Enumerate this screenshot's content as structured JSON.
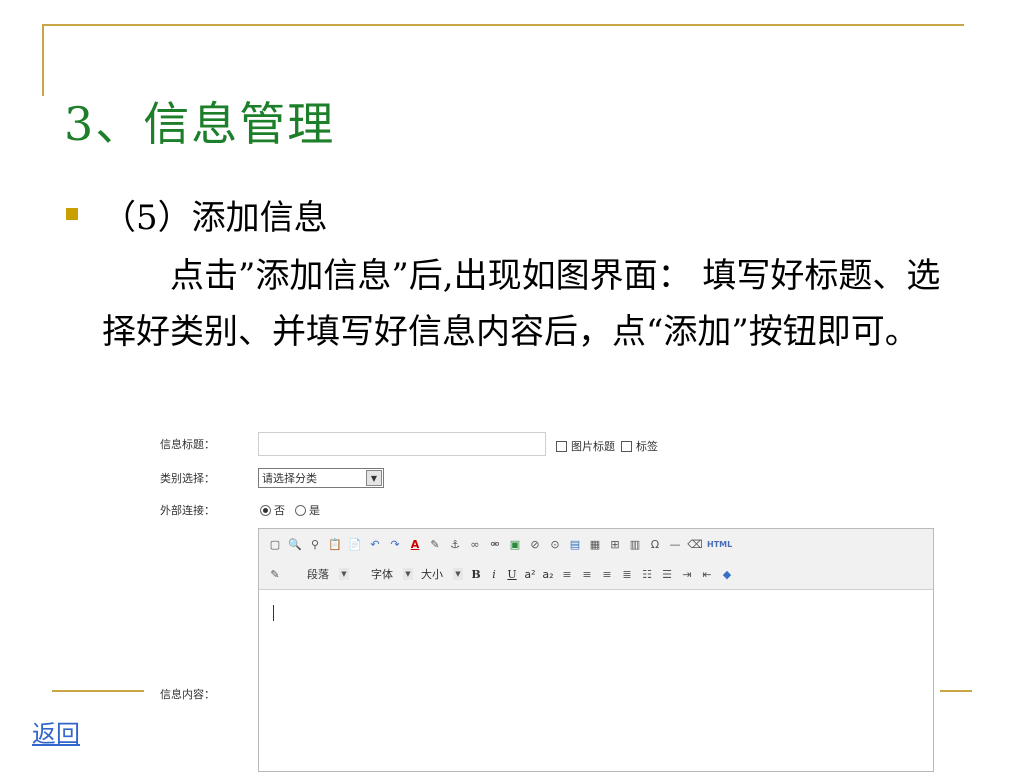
{
  "slide": {
    "title": "3、信息管理",
    "subheading": "（5）添加信息",
    "paragraph": "点击”添加信息”后,出现如图界面： 填写好标题、选择好类别、并填写好信息内容后，点“添加”按钮即可。",
    "back_link": "返回"
  },
  "form": {
    "title_label": "信息标题：",
    "image_title_label": "图片标题",
    "tag_label": "标签",
    "category_label": "类别选择：",
    "category_selected": "请选择分类",
    "external_link_label": "外部连接：",
    "radio_no": "否",
    "radio_yes": "是",
    "content_label": "信息内容："
  },
  "editor": {
    "toolbar1_icons": [
      "source-icon",
      "preview-icon",
      "find-icon",
      "paste-icon",
      "paste-word-icon",
      "undo-icon",
      "redo-icon",
      "font-color-icon",
      "highlight-icon",
      "anchor-icon",
      "link-icon",
      "unlink-icon",
      "image-icon",
      "flash-icon",
      "media-icon",
      "table-icon",
      "form-icon",
      "grid-icon",
      "layer-icon",
      "special-char-icon",
      "horizontal-rule-icon",
      "eraser-icon"
    ],
    "html_button": "HTML",
    "paragraph_combo": "段落",
    "font_combo": "字体",
    "size_combo": "大小",
    "bold": "B",
    "italic": "i",
    "underline": "U",
    "superscript": "a²",
    "subscript": "a₂"
  },
  "colors": {
    "accent_gold": "#c9a54a",
    "title_green": "#1e7f2a",
    "link_blue": "#3366cc",
    "bullet": "#c9a000"
  }
}
